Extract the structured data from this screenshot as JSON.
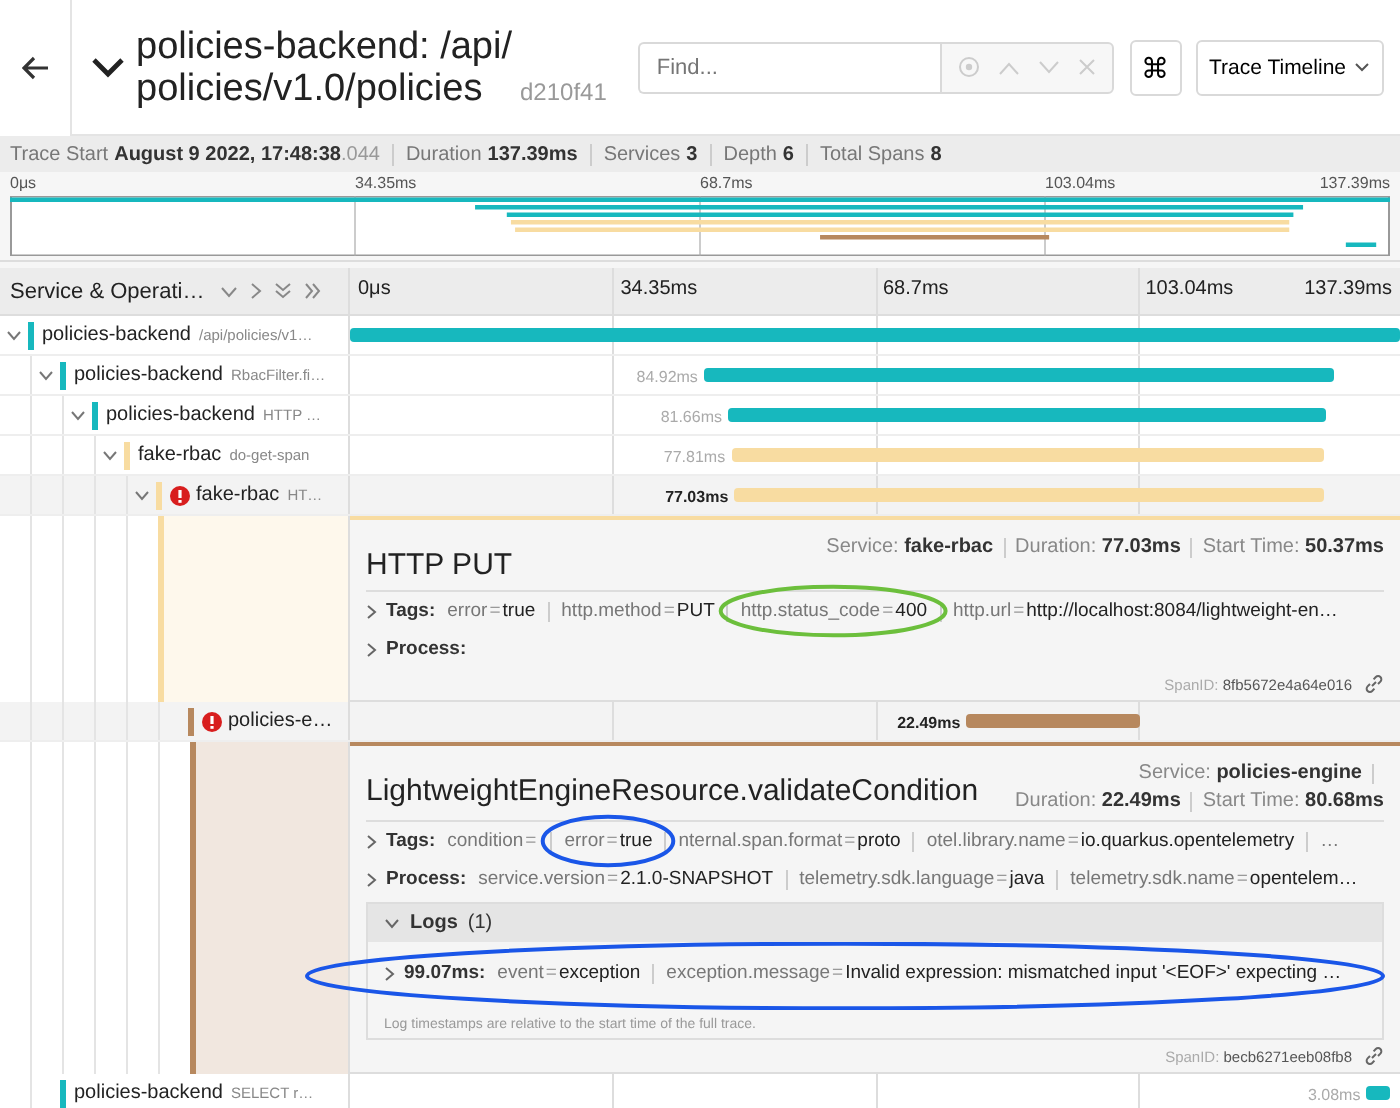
{
  "header": {
    "title_lines": [
      "policies-backend: /api/",
      "policies/v1.0/policies"
    ],
    "trace_id": "d210f41",
    "search": {
      "placeholder": "Find..."
    },
    "shortcut_button": "⌘",
    "view_select": "Trace Timeline"
  },
  "trace_info": [
    {
      "label": "Trace Start",
      "value": "**August 9 2022, 17:48:38**.044"
    },
    {
      "label": "Duration",
      "value": "**137.39ms**"
    },
    {
      "label": "Services",
      "value": "**3**"
    },
    {
      "label": "Depth",
      "value": "**6**"
    },
    {
      "label": "Total Spans",
      "value": "**8**"
    }
  ],
  "minimap": {
    "ticks": [
      "0μs",
      "34.35ms",
      "68.7ms",
      "103.04ms",
      "137.39ms"
    ]
  },
  "column_header": {
    "title": "Service & Operati…",
    "ticks": [
      "0μs",
      "34.35ms",
      "68.7ms",
      "103.04ms",
      "137.39ms"
    ]
  },
  "spans": [
    {
      "service": "policies-backend",
      "operation": "/api/policies/v1…",
      "color": "#17b8be",
      "expanded": true,
      "selected": false,
      "children": [
        {
          "service": "policies-backend",
          "operation": "RbacFilter.fi…",
          "color": "#17b8be",
          "expanded": true,
          "selected": false,
          "duration": "84.92ms",
          "children": [
            {
              "service": "policies-backend",
              "operation": "HTTP …",
              "color": "#17b8be",
              "expanded": true,
              "selected": false,
              "duration": "81.66ms",
              "children": [
                {
                  "service": "fake-rbac",
                  "operation": "do-get-span",
                  "color": "#f8dca1",
                  "expanded": true,
                  "selected": false,
                  "duration": "77.81ms",
                  "children": [
                    {
                      "service": "fake-rbac",
                      "operation": "HT…",
                      "color": "#f8dca1",
                      "expanded": true,
                      "selected": true,
                      "error": true,
                      "duration": "77.03ms",
                      "detail": {
                        "title": "HTTP PUT",
                        "service": {
                          "label": "Service:",
                          "value": "fake-rbac"
                        },
                        "duration": {
                          "label": "Duration:",
                          "value": "77.03ms"
                        },
                        "start_time": {
                          "label": "Start Time:",
                          "value": "50.37ms"
                        },
                        "tags": {
                          "label": "Tags:",
                          "items": [
                            {
                              "key": "error",
                              "sign": "=",
                              "value": "true"
                            },
                            {
                              "key": "http.method",
                              "sign": "=",
                              "value": "PUT"
                            },
                            {
                              "key": "http.status_code",
                              "sign": "=",
                              "value": "400",
                              "annotation": {
                                "kind": "ellipse",
                                "color": "#6cbf3c"
                              }
                            },
                            {
                              "key": "http.url",
                              "sign": "=",
                              "value": "http://localhost:8084/lightweight-en…"
                            }
                          ]
                        },
                        "process": {
                          "label": "Process:"
                        },
                        "span_id": {
                          "label": "SpanID:",
                          "value": "8fb5672e4a64e016"
                        }
                      },
                      "children": [
                        {
                          "service": "policies-e…",
                          "color": "#b7885e",
                          "selected": true,
                          "error": true,
                          "duration": "22.49ms",
                          "detail": {
                            "title": "LightweightEngineResource.validateCondition",
                            "service": {
                              "label": "Service:",
                              "value": "policies-engine"
                            },
                            "duration": {
                              "label": "Duration:",
                              "value": "22.49ms"
                            },
                            "start_time": {
                              "label": "Start Time:",
                              "value": "80.68ms"
                            },
                            "tags": {
                              "label": "Tags:",
                              "items": [
                                {
                                  "key": "condition",
                                  "sign": "="
                                },
                                {
                                  "key": "error",
                                  "sign": "=",
                                  "value": "true",
                                  "annotation": {
                                    "kind": "ellipse",
                                    "color": "#1a56e8"
                                  }
                                },
                                {
                                  "key": "nternal.span.format",
                                  "sign": "=",
                                  "value": "proto"
                                },
                                {
                                  "key": "otel.library.name",
                                  "sign": "=",
                                  "value": "io.quarkus.opentelemetry"
                                },
                                {
                                  "key": "…"
                                }
                              ]
                            },
                            "process": {
                              "label": "Process:",
                              "items": [
                                {
                                  "key": "service.version",
                                  "sign": "=",
                                  "value": "2.1.0-SNAPSHOT"
                                },
                                {
                                  "key": "telemetry.sdk.language",
                                  "sign": "=",
                                  "value": "java"
                                },
                                {
                                  "key": "telemetry.sdk.name",
                                  "sign": "=",
                                  "value": "opentelem…"
                                }
                              ]
                            },
                            "logs": {
                              "label": "Logs",
                              "count": "(1)",
                              "expanded": true,
                              "annotation": {
                                "kind": "ellipse",
                                "color": "#1a56e8"
                              },
                              "entries": [
                                {
                                  "time": "99.07ms:",
                                  "fields": [
                                    {
                                      "key": "event",
                                      "sign": "=",
                                      "value": "exception"
                                    },
                                    {
                                      "key": "exception.message",
                                      "sign": "=",
                                      "value": "Invalid expression: mismatched input '<EOF>' expecting …"
                                    }
                                  ]
                                }
                              ],
                              "note": "Log timestamps are relative to the start time of the full trace."
                            },
                            "span_id": {
                              "label": "SpanID:",
                              "value": "becb6271eeb08fb8"
                            }
                          }
                        }
                      ]
                    }
                  ]
                }
              ]
            }
          ]
        },
        {
          "service": "policies-backend",
          "operation": "SELECT r…",
          "color": "#17b8be",
          "selected": false,
          "duration": "3.08ms"
        }
      ]
    }
  ]
}
